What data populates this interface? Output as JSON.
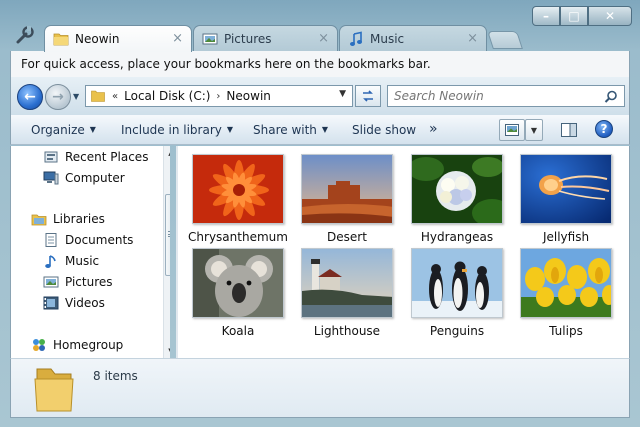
{
  "tabs": [
    {
      "label": "Neowin",
      "active": true,
      "icon": "folder-icon"
    },
    {
      "label": "Pictures",
      "active": false,
      "icon": "pictures-icon"
    },
    {
      "label": "Music",
      "active": false,
      "icon": "music-note-icon"
    }
  ],
  "tab_close_glyph": "×",
  "window_controls": {
    "minimize": "–",
    "maximize": "□",
    "close": "✕"
  },
  "bookmarks_bar": {
    "message": "For quick access, place your bookmarks here on the bookmarks bar."
  },
  "address": {
    "crumbs": [
      "Local Disk (C:)",
      "Neowin"
    ],
    "separator": "›",
    "prefix": "«",
    "dropdown": "▼"
  },
  "search": {
    "placeholder": "Search Neowin"
  },
  "commands": [
    {
      "label": "Organize",
      "has_menu": true
    },
    {
      "label": "Include in library",
      "has_menu": true
    },
    {
      "label": "Share with",
      "has_menu": true
    },
    {
      "label": "Slide show",
      "has_menu": false
    },
    {
      "label": "»",
      "has_menu": false
    }
  ],
  "help_label": "?",
  "nav_pane": {
    "items": [
      {
        "label": "Recent Places",
        "icon": "recent-places-icon",
        "indent": 1
      },
      {
        "label": "Computer",
        "icon": "computer-icon",
        "indent": 1
      },
      {
        "label": "Libraries",
        "icon": "libraries-icon",
        "indent": 0
      },
      {
        "label": "Documents",
        "icon": "documents-icon",
        "indent": 1
      },
      {
        "label": "Music",
        "icon": "music-icon",
        "indent": 1
      },
      {
        "label": "Pictures",
        "icon": "pictures-icon",
        "indent": 1
      },
      {
        "label": "Videos",
        "icon": "videos-icon",
        "indent": 1
      },
      {
        "label": "Homegroup",
        "icon": "homegroup-icon",
        "indent": 0
      }
    ]
  },
  "files": [
    {
      "name": "Chrysanthemum",
      "icon": "chrysanthemum-thumbnail"
    },
    {
      "name": "Desert",
      "icon": "desert-thumbnail"
    },
    {
      "name": "Hydrangeas",
      "icon": "hydrangeas-thumbnail"
    },
    {
      "name": "Jellyfish",
      "icon": "jellyfish-thumbnail"
    },
    {
      "name": "Koala",
      "icon": "koala-thumbnail"
    },
    {
      "name": "Lighthouse",
      "icon": "lighthouse-thumbnail"
    },
    {
      "name": "Penguins",
      "icon": "penguins-thumbnail"
    },
    {
      "name": "Tulips",
      "icon": "tulips-thumbnail"
    }
  ],
  "details": {
    "item_count": "8 items"
  },
  "colors": {
    "accent": "#2b6fd0",
    "frame": "#8aa3b3"
  }
}
